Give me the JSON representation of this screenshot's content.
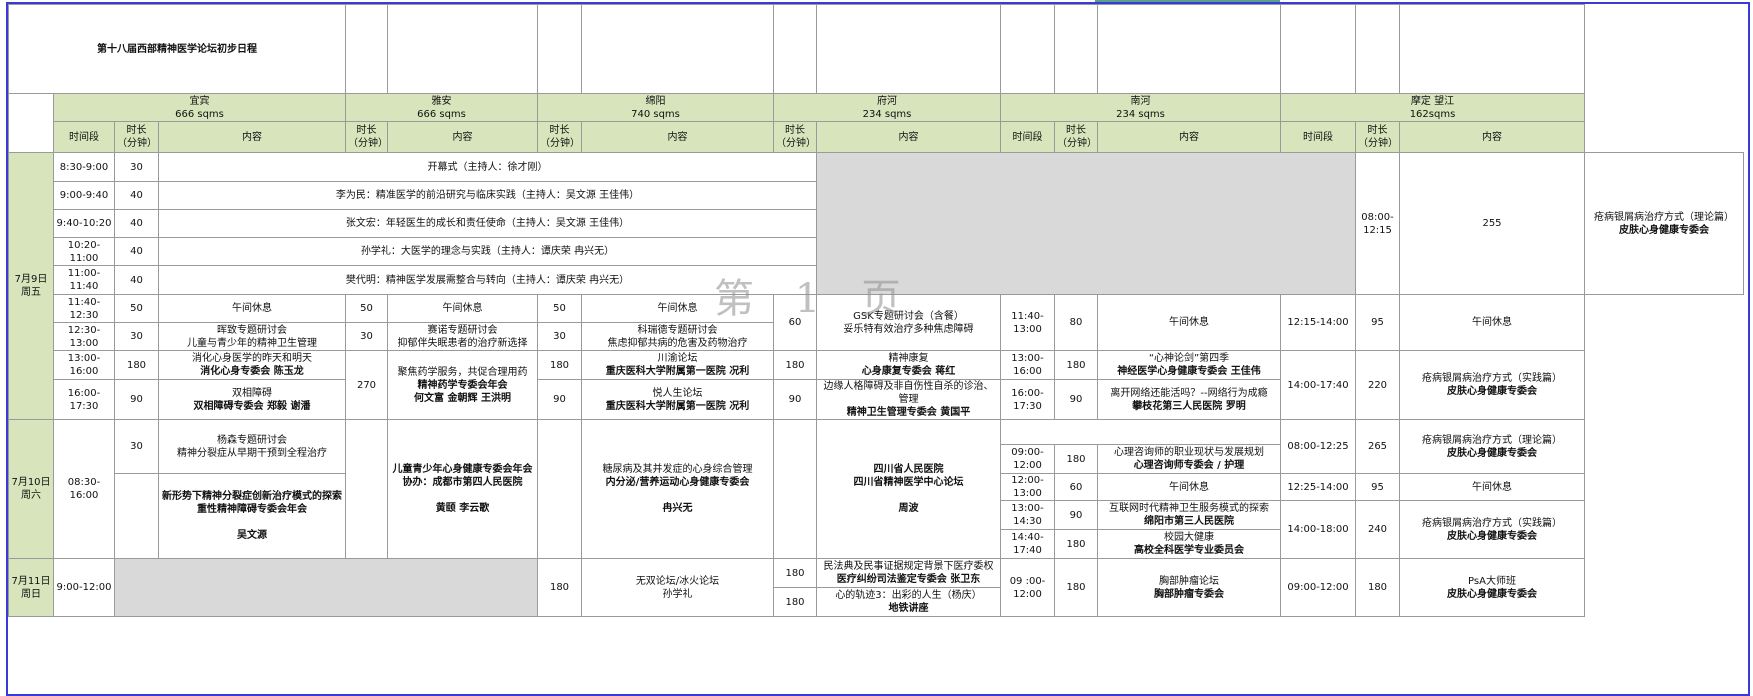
{
  "title": "第十八届西部精神医学论坛初步日程",
  "watermark": "第 1 页",
  "venues": {
    "yibin": {
      "name": "宜宾",
      "size": "666 sqms"
    },
    "yaan": {
      "name": "雅安",
      "size": "666 sqms"
    },
    "mianyang": {
      "name": "绵阳",
      "size": "740 sqms"
    },
    "fuhe": {
      "name": "府河",
      "size": "234 sqms"
    },
    "nanhe": {
      "name": "南河",
      "size": "234 sqms"
    },
    "moding": {
      "name": "摩定 望江",
      "size": "162sqms"
    }
  },
  "headers": {
    "time": "时间段",
    "duration": "时长\n（分钟）",
    "content": "内容"
  },
  "days": {
    "d1": "7月9日\n周五",
    "d2": "7月10日\n周六",
    "d3": "7月11日\n周日"
  },
  "r1": {
    "time": "8:30-9:00",
    "dur": "30",
    "content": "开幕式（主持人：徐才刚）"
  },
  "r2": {
    "time": "9:00-9:40",
    "dur": "40",
    "content": "李为民：精准医学的前沿研究与临床实践（主持人：吴文源 王佳伟）"
  },
  "r3": {
    "time": "9:40-10:20",
    "dur": "40",
    "content": "张文宏：年轻医生的成长和责任使命（主持人：吴文源 王佳伟）"
  },
  "r4": {
    "time": "10:20-11:00",
    "dur": "40",
    "content": "孙学礼：大医学的理念与实践（主持人：谭庆荣 冉兴无）"
  },
  "r5": {
    "time": "11:00-11:40",
    "dur": "40",
    "content": "樊代明：精神医学发展需整合与转向（主持人：谭庆荣 冉兴无）"
  },
  "r6": {
    "time": "11:40-12:30",
    "dur": "50",
    "c": "午间休息",
    "ya_dur": "50",
    "ya_c": "午间休息",
    "my_dur": "50",
    "my_c": "午间休息",
    "fh_dur": "60",
    "fh_c1": "GSK专题研讨会（含餐）",
    "fh_c2": "妥乐特有效治疗多种焦虑障碍",
    "nh_time": "11:40-13:00",
    "nh_dur": "80",
    "nh_c": "午间休息",
    "md_time": "12:15-14:00",
    "md_dur": "95",
    "md_c": "午间休息"
  },
  "r7": {
    "time": "12:30-13:00",
    "dur": "30",
    "c1": "晖致专题研讨会",
    "c2": "儿童与青少年的精神卫生管理",
    "ya_dur": "30",
    "ya_c1": "赛诺专题研讨会",
    "ya_c2": "抑郁伴失眠患者的治疗新选择",
    "my_dur": "30",
    "my_c1": "科瑞德专题研讨会",
    "my_c2": "焦虑抑郁共病的危害及药物治疗"
  },
  "r8": {
    "time": "13:00-16:00",
    "dur": "180",
    "c1": "消化心身医学的昨天和明天",
    "c2": "消化心身专委会 陈玉龙",
    "ya_dur": "270",
    "ya_c1": "聚焦药学服务，共促合理用药",
    "ya_c2": "精神药学专委会年会",
    "ya_c3": "何文富 金朝辉 王洪明",
    "my_dur": "180",
    "my_c1": "川渝论坛",
    "my_c2": "重庆医科大学附属第一医院 况利",
    "fh_dur": "180",
    "fh_c1": "精神康复",
    "fh_c2": "心身康复专委会 蒋红",
    "nh_time": "13:00-16:00",
    "nh_dur": "180",
    "nh_c1": "“心神论剑”第四季",
    "nh_c2": "神经医学心身健康专委会 王佳伟",
    "md_time": "14:00-17:40",
    "md_dur": "220",
    "md_c1": "疮病银屑病治疗方式（实践篇）",
    "md_c2": "皮肤心身健康专委会"
  },
  "r9": {
    "time": "16:00-17:30",
    "dur": "90",
    "c1": "双相障碍",
    "c2": "双相障碍专委会 郑毅 谢潘",
    "my_dur": "90",
    "my_c1": "悦人生论坛",
    "my_c2": "重庆医科大学附属第一医院 况利",
    "fh_dur": "90",
    "fh_c1": "边缘人格障碍及非自伤性自杀的诊治、管理",
    "fh_c2": "精神卫生管理专委会 黄国平",
    "nh_time": "16:00-17:30",
    "nh_dur": "90",
    "nh_c1": "离开网络还能活吗？--网络行为成瘾",
    "nh_c2": "攀枝花第三人民医院 罗明"
  },
  "md_r1": {
    "time": "08:00-12:15",
    "dur": "255",
    "c1": "疮病银屑病治疗方式（理论篇）",
    "c2": "皮肤心身健康专委会"
  },
  "d2": {
    "time": "08:30-16:00",
    "yb_dur": "30",
    "yb_c1": "杨森专题研讨会",
    "yb_c2": "精神分裂症从早期干预到全程治疗",
    "yb_m1": "新形势下精神分裂症创新治疗模式的探索",
    "yb_m2": "重性精神障碍专委会年会",
    "yb_m3": "吴文源",
    "ya_c1": "儿童青少年心身健康专委会年会",
    "ya_c2": "协办：成都市第四人民医院",
    "ya_c3": "黄颐 李云歌",
    "my_c1": "糖尿病及其并发症的心身综合管理",
    "my_c2": "内分泌/营养运动心身健康专委会",
    "my_c3": "冉兴无",
    "fh_c1": "四川省人民医院",
    "fh_c2": "四川省精神医学中心论坛",
    "fh_c3": "周波",
    "nh1_time": "09:00-12:00",
    "nh1_dur": "180",
    "nh1_c1": "心理咨询师的职业现状与发展规划",
    "nh1_c2": "心理咨询师专委会 / 护理",
    "nh2_time": "12:00-13:00",
    "nh2_dur": "60",
    "nh2_c": "午间休息",
    "nh3_time": "13:00-14:30",
    "nh3_dur": "90",
    "nh3_c1": "互联网时代精神卫生服务模式的探索",
    "nh3_c2": "绵阳市第三人民医院",
    "nh4_time": "14:40-17:40",
    "nh4_dur": "180",
    "nh4_c1": "校园大健康",
    "nh4_c2": "高校全科医学专业委员会",
    "md1_time": "08:00-12:25",
    "md1_dur": "265",
    "md1_c1": "疮病银屑病治疗方式（理论篇）",
    "md1_c2": "皮肤心身健康专委会",
    "md2_time": "12:25-14:00",
    "md2_dur": "95",
    "md2_c": "午间休息",
    "md3_time": "14:00-18:00",
    "md3_dur": "240",
    "md3_c1": "疮病银屑病治疗方式（实践篇）",
    "md3_c2": "皮肤心身健康专委会"
  },
  "d3": {
    "time": "9:00-12:00",
    "my_dur": "180",
    "my_c1": "无双论坛/冰火论坛",
    "my_c2": "孙学礼",
    "fh1_dur": "180",
    "fh1_c1": "民法典及民事证据规定背景下医疗委权",
    "fh1_c2": "医疗纠纷司法鉴定专委会 张卫东",
    "fh2_dur": "180",
    "fh2_c1": "心的轨迹3：出彩的人生（杨庆）",
    "fh2_c2": "地铁讲座",
    "nh_time": "09 :00-12:00",
    "nh_dur": "180",
    "nh_c1": "胸部肿瘤论坛",
    "nh_c2": "胸部肿瘤专委会",
    "md_time": "09:00-12:00",
    "md_dur": "180",
    "md_c1": "PsA大师班",
    "md_c2": "皮肤心身健康专委会"
  }
}
